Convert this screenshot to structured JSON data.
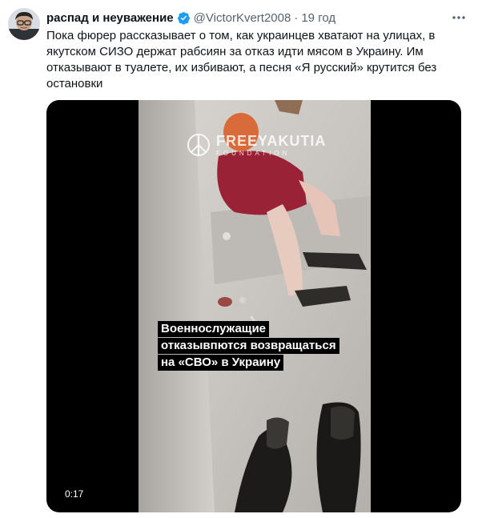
{
  "tweet": {
    "author": {
      "display_name": "распад и неуважение",
      "handle": "@VictorKvert2008",
      "verified": true
    },
    "separator": "·",
    "timestamp": "19 год",
    "text": "Пока фюрер рассказывает о том, как украинцев хватают на улицах, в\nякутском СИЗО держат рабсиян за отказ идти мясом в Украину. Им\nотказывают в туалете, их избивают, а песня «Я русский» крутится без\nостановки",
    "media": {
      "type": "video",
      "duration": "0:17",
      "watermark_title": "FREEYAKUTIA",
      "watermark_subtitle": "FOUNDATION",
      "caption_lines": [
        "Военнослужащие",
        "отказывпются возвращаться",
        "на «СВО» в Украину"
      ]
    }
  },
  "colors": {
    "verified_badge": "#1d9bf0",
    "secondary_text": "#536471",
    "primary_text": "#0f1419",
    "media_background": "#000000"
  },
  "icons": [
    "avatar",
    "verified-badge-icon",
    "more-options-icon",
    "peace-icon"
  ]
}
